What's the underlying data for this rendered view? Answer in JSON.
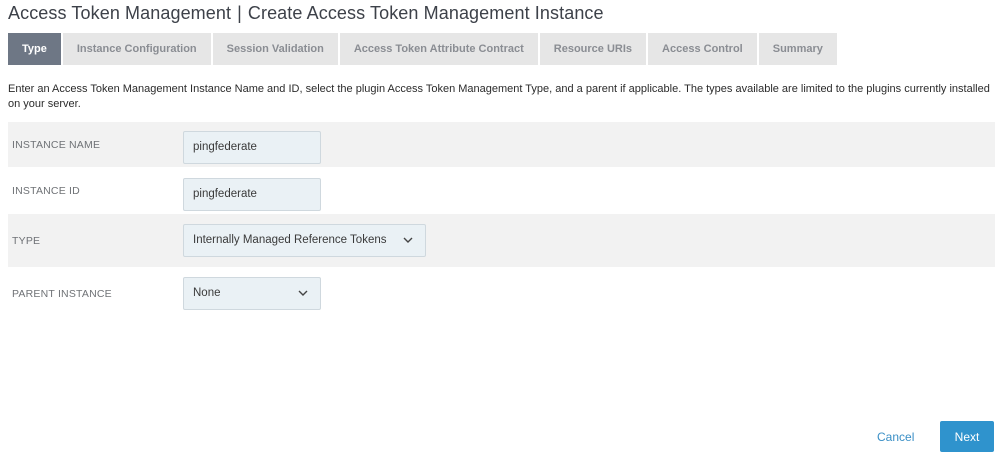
{
  "header": {
    "title_main": "Access Token Management",
    "title_separator": "|",
    "title_sub": "Create Access Token Management Instance"
  },
  "tabs": [
    {
      "label": "Type",
      "active": true
    },
    {
      "label": "Instance Configuration",
      "active": false
    },
    {
      "label": "Session Validation",
      "active": false
    },
    {
      "label": "Access Token Attribute Contract",
      "active": false
    },
    {
      "label": "Resource URIs",
      "active": false
    },
    {
      "label": "Access Control",
      "active": false
    },
    {
      "label": "Summary",
      "active": false
    }
  ],
  "intro": "Enter an Access Token Management Instance Name and ID, select the plugin Access Token Management Type, and a parent if applicable. The types available are limited to the plugins currently installed on your server.",
  "form": {
    "instance_name": {
      "label": "INSTANCE NAME",
      "value": "pingfederate"
    },
    "instance_id": {
      "label": "INSTANCE ID",
      "value": "pingfederate"
    },
    "type": {
      "label": "TYPE",
      "value": "Internally Managed Reference Tokens"
    },
    "parent_instance": {
      "label": "PARENT INSTANCE",
      "value": "None"
    }
  },
  "actions": {
    "cancel_label": "Cancel",
    "next_label": "Next"
  },
  "colors": {
    "active_tab": "#6e7785",
    "inactive_tab": "#e6e6e6",
    "field_bg": "#eaf1f5",
    "primary_button": "#2f93cd",
    "link": "#3a8fc6"
  }
}
